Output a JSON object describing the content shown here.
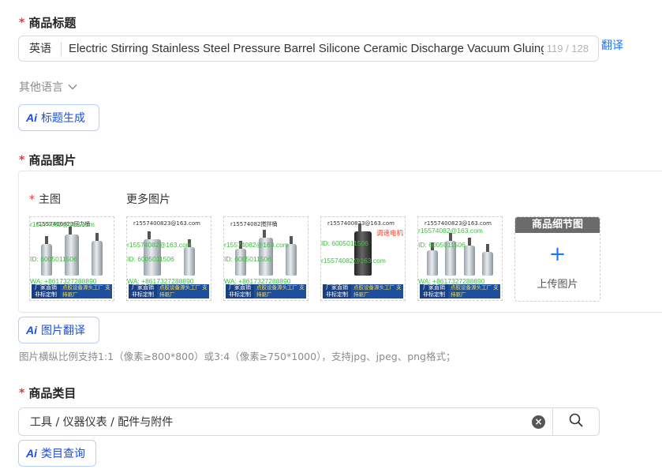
{
  "title_section": {
    "label": "商品标题",
    "language_prefix": "英语",
    "title_value": "Electric Stirring Stainless Steel Pressure Barrel Silicone Ceramic Discharge Vacuum Gluing Machine",
    "char_count": "119 / 128",
    "translate_link": "翻译",
    "other_languages": "其他语言",
    "ai_generate_label": "标题生成",
    "ai_mark": "Ai"
  },
  "images_section": {
    "label": "商品图片",
    "main_label": "主图",
    "more_label": "更多图片",
    "thumbnails": [
      {
        "top_text": "r1557400823压力桶",
        "wm1": "r15574082@163.com",
        "wm2": "ID: 6005011506",
        "wm3": "WA: +8617327288890",
        "badge_left": "厂家直销 非标定制",
        "badge_right": "点胶设备源头工厂 支持驱厂"
      },
      {
        "top_text": "r1557400823@163.com",
        "wm1": "r15574082@163.com",
        "wm2": "ID: 6005011506",
        "wm3": "WA: +8617327288890",
        "badge_left": "厂家直销 非标定制",
        "badge_right": "点胶设备源头工厂 支持驱厂"
      },
      {
        "top_text": "r15574082搅拌桶",
        "wm1": "r15574082@163.com",
        "wm2": "ID: 6005011506",
        "wm3": "WA: +8617327288890",
        "badge_left": "厂家直销 非标定制",
        "badge_right": "点胶设备源头工厂 支持驱厂"
      },
      {
        "top_text": "r1557400823@163.com",
        "wm1": "调速电机",
        "wm2": "ID: 6005011506",
        "wm3": "r15574082@163.com",
        "badge_left": "厂家直销 非标定制",
        "badge_right": "点胶设备源头工厂 支持驱厂"
      },
      {
        "top_text": "r1557400823@163.com",
        "wm1": "r15574082@163.com",
        "wm2": "ID: 6005011506",
        "wm3": "WA: +8617327288890",
        "badge_left": "厂家直销 非标定制",
        "badge_right": "点胶设备源头工厂 支持驱厂"
      }
    ],
    "detail_header": "商品细节图",
    "upload_label": "上传图片",
    "ai_translate_label": "图片翻译",
    "ai_mark": "Ai",
    "hint": "图片横纵比例支持1:1（像素≥800*800）或3:4（像素≥750*1000），支持jpg、jpeg、png格式；"
  },
  "category_section": {
    "label": "商品类目",
    "value": "工具 / 仪器仪表 / 配件与附件",
    "ai_query_label": "类目查询",
    "ai_mark": "Ai"
  },
  "colors": {
    "accent": "#1677ff",
    "required": "#e4393c",
    "watermark": "#39c23a"
  }
}
